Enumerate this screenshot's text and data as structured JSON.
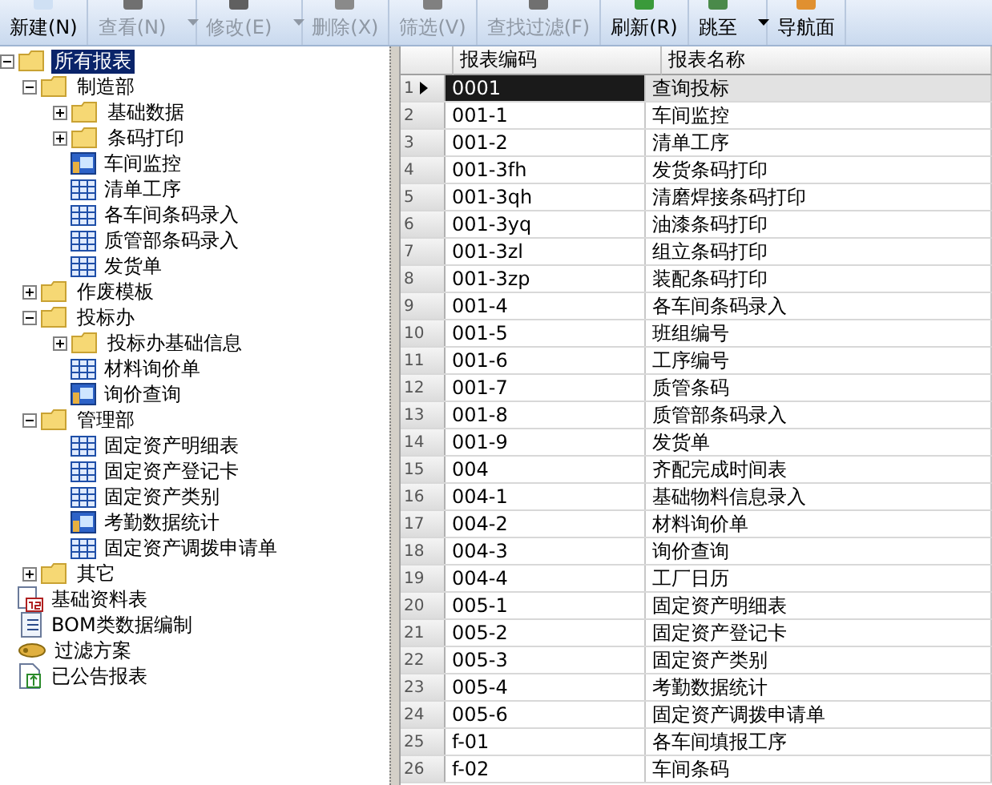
{
  "toolbar": [
    {
      "label": "新建(N)",
      "kind": "new",
      "disabled": false,
      "dropdown": false
    },
    {
      "label": "查看(N)",
      "kind": "view",
      "disabled": true,
      "dropdown": true
    },
    {
      "label": "修改(E)",
      "kind": "edit",
      "disabled": true,
      "dropdown": true
    },
    {
      "label": "删除(X)",
      "kind": "delete",
      "disabled": true,
      "dropdown": false
    },
    {
      "label": "筛选(V)",
      "kind": "filter",
      "disabled": true,
      "dropdown": false
    },
    {
      "label": "查找过滤(F)",
      "kind": "find",
      "disabled": true,
      "dropdown": false
    },
    {
      "label": "刷新(R)",
      "kind": "refresh",
      "disabled": false,
      "dropdown": false
    },
    {
      "label": "跳至",
      "kind": "jump",
      "disabled": false,
      "dropdown": true
    },
    {
      "label": "导航面",
      "kind": "nav",
      "disabled": false,
      "dropdown": false
    }
  ],
  "tree": [
    {
      "label": "所有报表",
      "kind": "folder",
      "expanded": true,
      "selected": true,
      "children": [
        {
          "label": "制造部",
          "kind": "folder",
          "expanded": true,
          "selected": false,
          "children": [
            {
              "label": "基础数据",
              "kind": "folder",
              "expanded": false,
              "selected": false
            },
            {
              "label": "条码打印",
              "kind": "folder",
              "expanded": false,
              "selected": false
            },
            {
              "label": "车间监控",
              "kind": "query",
              "selected": false
            },
            {
              "label": "清单工序",
              "kind": "report",
              "selected": false
            },
            {
              "label": "各车间条码录入",
              "kind": "report",
              "selected": false
            },
            {
              "label": "质管部条码录入",
              "kind": "report",
              "selected": false
            },
            {
              "label": "发货单",
              "kind": "report",
              "selected": false
            }
          ]
        },
        {
          "label": "作废模板",
          "kind": "folder",
          "expanded": false,
          "selected": false
        },
        {
          "label": "投标办",
          "kind": "folder",
          "expanded": true,
          "selected": false,
          "children": [
            {
              "label": "投标办基础信息",
              "kind": "folder",
              "expanded": false,
              "selected": false
            },
            {
              "label": "材料询价单",
              "kind": "report",
              "selected": false
            },
            {
              "label": "询价查询",
              "kind": "query",
              "selected": false
            }
          ]
        },
        {
          "label": "管理部",
          "kind": "folder",
          "expanded": true,
          "selected": false,
          "children": [
            {
              "label": "固定资产明细表",
              "kind": "report",
              "selected": false
            },
            {
              "label": "固定资产登记卡",
              "kind": "report",
              "selected": false
            },
            {
              "label": "固定资产类别",
              "kind": "report",
              "selected": false
            },
            {
              "label": "考勤数据统计",
              "kind": "query",
              "selected": false
            },
            {
              "label": "固定资产调拨申请单",
              "kind": "report",
              "selected": false
            }
          ]
        },
        {
          "label": "其它",
          "kind": "folder",
          "expanded": false,
          "selected": false
        }
      ]
    },
    {
      "label": "基础资料表",
      "kind": "calendar",
      "selected": false
    },
    {
      "label": "BOM类数据编制",
      "kind": "list",
      "selected": false
    },
    {
      "label": "过滤方案",
      "kind": "scheme",
      "selected": false
    },
    {
      "label": "已公告报表",
      "kind": "published",
      "selected": false
    }
  ],
  "table": {
    "columns": [
      "报表编码",
      "报表名称"
    ],
    "rows": [
      {
        "num": "1",
        "code": "0001",
        "name": "查询投标",
        "selected": true
      },
      {
        "num": "2",
        "code": "001-1",
        "name": "车间监控",
        "selected": false
      },
      {
        "num": "3",
        "code": "001-2",
        "name": "清单工序",
        "selected": false
      },
      {
        "num": "4",
        "code": "001-3fh",
        "name": "发货条码打印",
        "selected": false
      },
      {
        "num": "5",
        "code": "001-3qh",
        "name": "清磨焊接条码打印",
        "selected": false
      },
      {
        "num": "6",
        "code": "001-3yq",
        "name": "油漆条码打印",
        "selected": false
      },
      {
        "num": "7",
        "code": "001-3zl",
        "name": "组立条码打印",
        "selected": false
      },
      {
        "num": "8",
        "code": "001-3zp",
        "name": "装配条码打印",
        "selected": false
      },
      {
        "num": "9",
        "code": "001-4",
        "name": "各车间条码录入",
        "selected": false
      },
      {
        "num": "10",
        "code": "001-5",
        "name": "班组编号",
        "selected": false
      },
      {
        "num": "11",
        "code": "001-6",
        "name": "工序编号",
        "selected": false
      },
      {
        "num": "12",
        "code": "001-7",
        "name": "质管条码",
        "selected": false
      },
      {
        "num": "13",
        "code": "001-8",
        "name": "质管部条码录入",
        "selected": false
      },
      {
        "num": "14",
        "code": "001-9",
        "name": "发货单",
        "selected": false
      },
      {
        "num": "15",
        "code": "004",
        "name": "齐配完成时间表",
        "selected": false
      },
      {
        "num": "16",
        "code": "004-1",
        "name": "基础物料信息录入",
        "selected": false
      },
      {
        "num": "17",
        "code": "004-2",
        "name": "材料询价单",
        "selected": false
      },
      {
        "num": "18",
        "code": "004-3",
        "name": "询价查询",
        "selected": false
      },
      {
        "num": "19",
        "code": "004-4",
        "name": "工厂日历",
        "selected": false
      },
      {
        "num": "20",
        "code": "005-1",
        "name": "固定资产明细表",
        "selected": false
      },
      {
        "num": "21",
        "code": "005-2",
        "name": "固定资产登记卡",
        "selected": false
      },
      {
        "num": "22",
        "code": "005-3",
        "name": "固定资产类别",
        "selected": false
      },
      {
        "num": "23",
        "code": "005-4",
        "name": "考勤数据统计",
        "selected": false
      },
      {
        "num": "24",
        "code": "005-6",
        "name": "固定资产调拨申请单",
        "selected": false
      },
      {
        "num": "25",
        "code": "f-01",
        "name": "各车间填报工序",
        "selected": false
      },
      {
        "num": "26",
        "code": "f-02",
        "name": "车间条码",
        "selected": false
      }
    ]
  }
}
